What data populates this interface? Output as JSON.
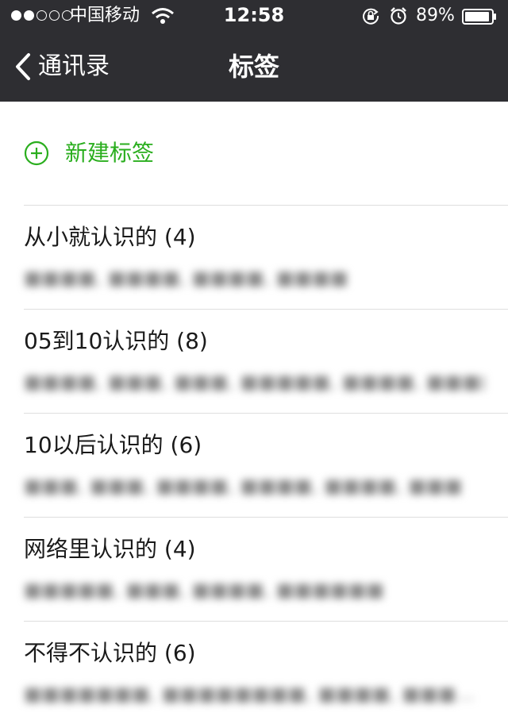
{
  "status_bar": {
    "carrier": "中国移动",
    "time": "12:58",
    "battery_percent": "89%",
    "signal_bars_filled": 2,
    "signal_bars_total": 5
  },
  "nav": {
    "back_label": "通讯录",
    "title": "标签"
  },
  "new_tag": {
    "label": "新建标签",
    "accent_color": "#2aae1e"
  },
  "tags": [
    {
      "title": "从小就认识的 (4)",
      "members": "■■■■, ■■■■, ■■■■, ■■■■"
    },
    {
      "title": "05到10认识的 (8)",
      "members": "■■■■, ■■■, ■■■, ■■■■■, ■■■■, ■■■■..."
    },
    {
      "title": "10以后认识的 (6)",
      "members": "■■■, ■■■, ■■■■, ■■■■, ■■■■, ■■■"
    },
    {
      "title": "网络里认识的 (4)",
      "members": "■■■■■, ■■■, ■■■■, ■■■■■■"
    },
    {
      "title": "不得不认识的 (6)",
      "members": "■■■■■■■, ■■■■■■■■, ■■■■, ■■■..."
    }
  ],
  "icons": {
    "back": "chevron-left-icon",
    "new_tag": "plus-circle-icon",
    "wifi": "wifi-icon",
    "rotation_lock": "rotation-lock-icon",
    "alarm": "alarm-icon",
    "battery": "battery-icon"
  }
}
